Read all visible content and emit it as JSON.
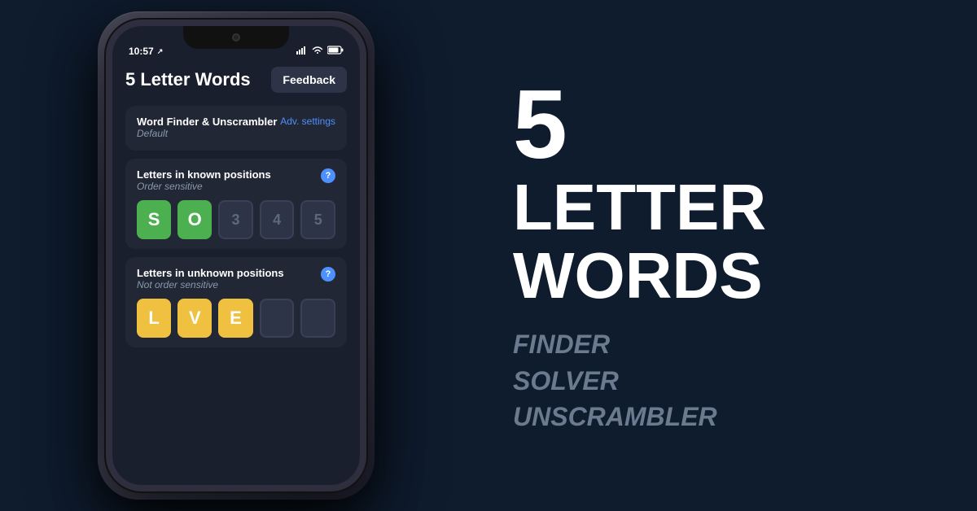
{
  "background_color": "#0f1c2e",
  "phone_section": {
    "status_bar": {
      "time": "10:57",
      "location_icon": "↗",
      "signal_icon": "▄▄▄",
      "wifi_icon": "wifi",
      "battery_icon": "▮"
    },
    "app": {
      "title": "5 Letter Words",
      "feedback_button": "Feedback",
      "word_finder_section": {
        "title": "Word Finder & Unscrambler",
        "subtitle": "Default",
        "adv_settings_label": "Adv. settings"
      },
      "known_positions_section": {
        "title": "Letters in known positions",
        "subtitle": "Order sensitive",
        "tiles": [
          {
            "letter": "S",
            "type": "green"
          },
          {
            "letter": "O",
            "type": "green"
          },
          {
            "label": "3",
            "type": "number"
          },
          {
            "label": "4",
            "type": "number"
          },
          {
            "label": "5",
            "type": "number"
          }
        ]
      },
      "unknown_positions_section": {
        "title": "Letters in unknown positions",
        "subtitle": "Not order sensitive",
        "tiles": [
          {
            "letter": "L",
            "type": "yellow"
          },
          {
            "letter": "V",
            "type": "yellow"
          },
          {
            "letter": "E",
            "type": "yellow"
          },
          {
            "label": "",
            "type": "empty"
          },
          {
            "label": "",
            "type": "empty"
          }
        ]
      }
    }
  },
  "text_section": {
    "number": "5",
    "line1": "LETTER",
    "line2": "WORDS",
    "taglines": [
      "FINDER",
      "SOLVER",
      "UNSCRAMBLER"
    ]
  }
}
